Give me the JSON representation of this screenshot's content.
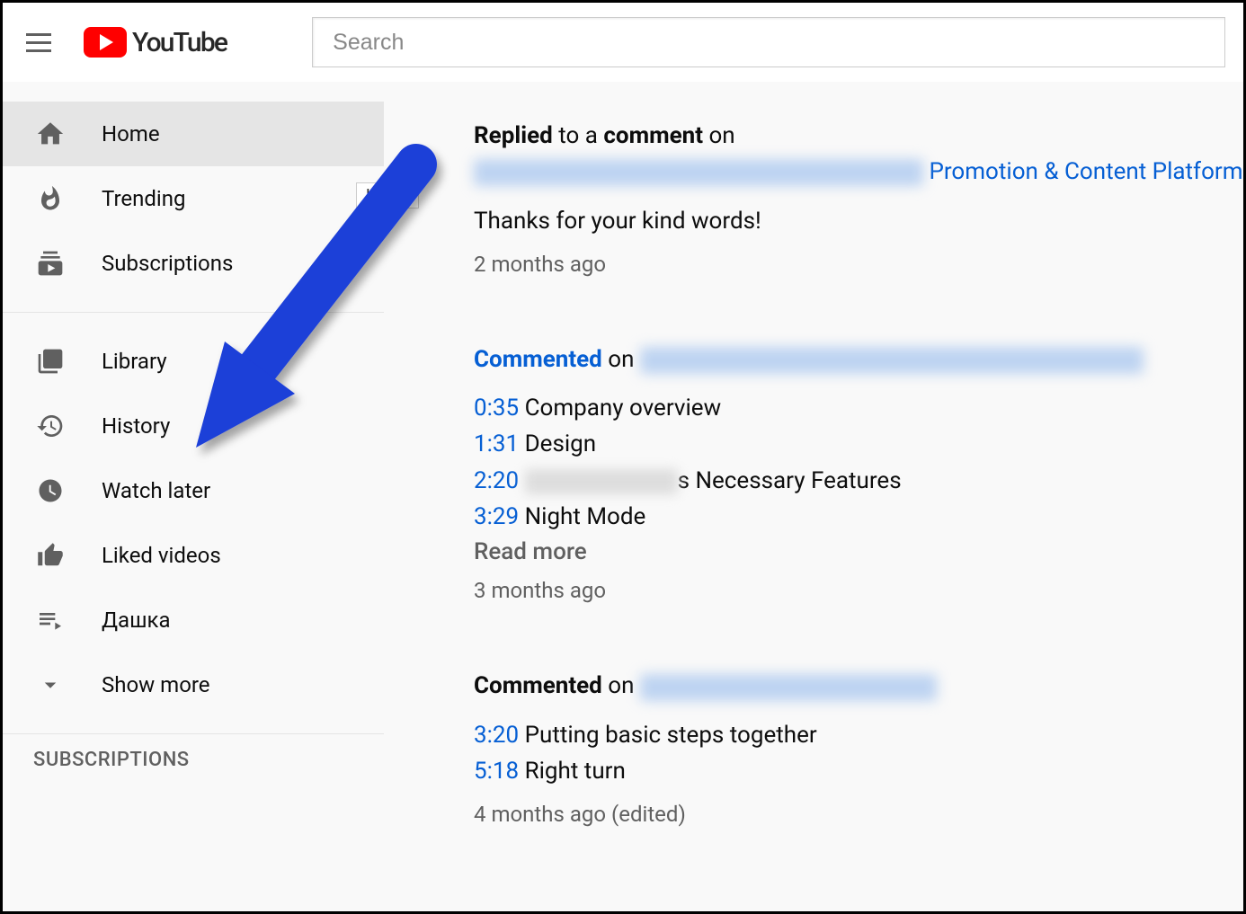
{
  "header": {
    "logo_text": "YouTube",
    "search_placeholder": "Search"
  },
  "sidebar": {
    "section1": [
      {
        "label": "Home",
        "key": "home",
        "active": true
      },
      {
        "label": "Trending",
        "key": "trending"
      },
      {
        "label": "Subscriptions",
        "key": "subscriptions"
      }
    ],
    "section2": [
      {
        "label": "Library",
        "key": "library"
      },
      {
        "label": "History",
        "key": "history"
      },
      {
        "label": "Watch later",
        "key": "watch-later"
      },
      {
        "label": "Liked videos",
        "key": "liked-videos"
      },
      {
        "label": "Дашка",
        "key": "playlist-dashka"
      },
      {
        "label": "Show more",
        "key": "show-more"
      }
    ],
    "subscriptions_heading": "SUBSCRIPTIONS"
  },
  "activities": [
    {
      "type": "replied",
      "head_prefix": "Replied",
      "head_mid": " to a ",
      "head_bold2": "comment",
      "head_after": " on",
      "link_text": "Promotion & Content Platform",
      "body": "Thanks for your kind words!",
      "timestamp": "2 months ago"
    },
    {
      "type": "commented",
      "head_prefix": "Commented",
      "head_after": " on ",
      "lines": [
        {
          "time": "0:35",
          "text": " Company overview"
        },
        {
          "time": "1:31",
          "text": " Design"
        },
        {
          "time": "2:20",
          "text_after": "s Necessary Features"
        },
        {
          "time": "3:29",
          "text": " Night Mode"
        }
      ],
      "read_more": "Read more",
      "timestamp": "3 months ago"
    },
    {
      "type": "commented",
      "head_prefix": "Commented",
      "head_after": " on ",
      "lines": [
        {
          "time": "3:20",
          "text": " Putting basic steps together"
        },
        {
          "time": "5:18",
          "text": " Right turn"
        }
      ],
      "timestamp": "4 months ago (edited)"
    }
  ],
  "tooltip_text": "Home"
}
